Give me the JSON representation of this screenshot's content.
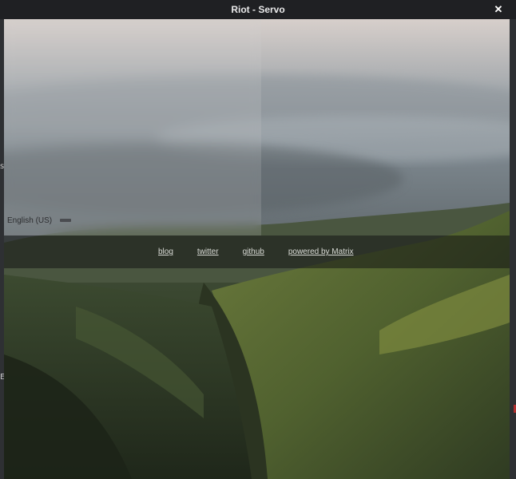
{
  "window": {
    "title": "Riot - Servo",
    "close_glyph": "✕"
  },
  "login": {
    "language_label": "English (US)"
  },
  "footer": {
    "links": [
      {
        "label": "blog"
      },
      {
        "label": "twitter"
      },
      {
        "label": "github"
      },
      {
        "label": "powered by Matrix"
      }
    ]
  },
  "desktop": {
    "left_fragments": [
      "s",
      "E"
    ]
  },
  "colors": {
    "titlebar_bg": "#1f2023",
    "title_text": "#e9e9ea",
    "footer_bar": "#141614",
    "link_text": "#d9dbd6"
  }
}
